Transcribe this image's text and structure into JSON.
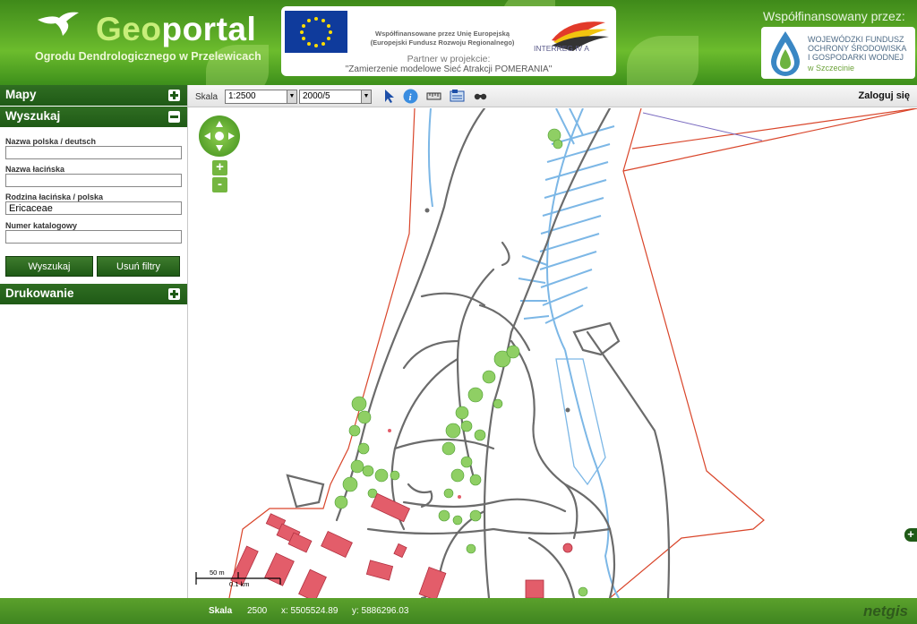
{
  "header": {
    "title_geo": "Geo",
    "title_portal": "portal",
    "subtitle": "Ogrodu Dendrologicznego w Przelewicach",
    "eu_text_line1": "Współfinansowane przez Unię Europejską",
    "eu_text_line2": "(Europejski Fundusz Rozwoju Regionalnego)",
    "interreg_label": "INTERREG IV A",
    "partner_label": "Partner w projekcie:",
    "partner_project": "\"Zamierzenie modelowe Sieć Atrakcji POMERANIA\"",
    "cofunded_label": "Współfinansowany przez:",
    "wfos_lines": [
      "WOJEWÓDZKI FUNDUSZ",
      "OCHRONY ŚRODOWISKA",
      "I GOSPODARKI WODNEJ"
    ],
    "wfos_city": "w Szczecinie"
  },
  "sidebar": {
    "maps_label": "Mapy",
    "search_label": "Wyszukaj",
    "print_label": "Drukowanie",
    "fields": [
      {
        "label": "Nazwa polska / deutsch",
        "value": ""
      },
      {
        "label": "Nazwa łacińska",
        "value": ""
      },
      {
        "label": "Rodzina łacińska / polska",
        "value": "Ericaceae"
      },
      {
        "label": "Numer katalogowy",
        "value": ""
      }
    ],
    "search_button": "Wyszukaj",
    "clear_button": "Usuń filtry"
  },
  "toolbar": {
    "scale_label": "Skala",
    "scale_value": "1:2500",
    "print_scale_value": "2000/5",
    "login_label": "Zaloguj się",
    "tool_icons": [
      "select-pointer-icon",
      "info-icon",
      "measure-ruler-icon",
      "layers-icon",
      "binoculars-icon"
    ]
  },
  "map": {
    "zoom_in": "+",
    "zoom_out": "-",
    "scalebar_top": "50 m",
    "scalebar_bottom": "0.1 km",
    "expand_right": "+",
    "colors": {
      "boundary": "#d9452a",
      "paths": "#6b6b6b",
      "water": "#7cb7e6",
      "buildings": "#e35d6a",
      "trees": "#6fb64a"
    }
  },
  "status": {
    "scale_label": "Skala",
    "scale_value": "2500",
    "x_coord": "x: 5505524.89",
    "y_coord": "y: 5886296.03",
    "brand": "netgis"
  }
}
